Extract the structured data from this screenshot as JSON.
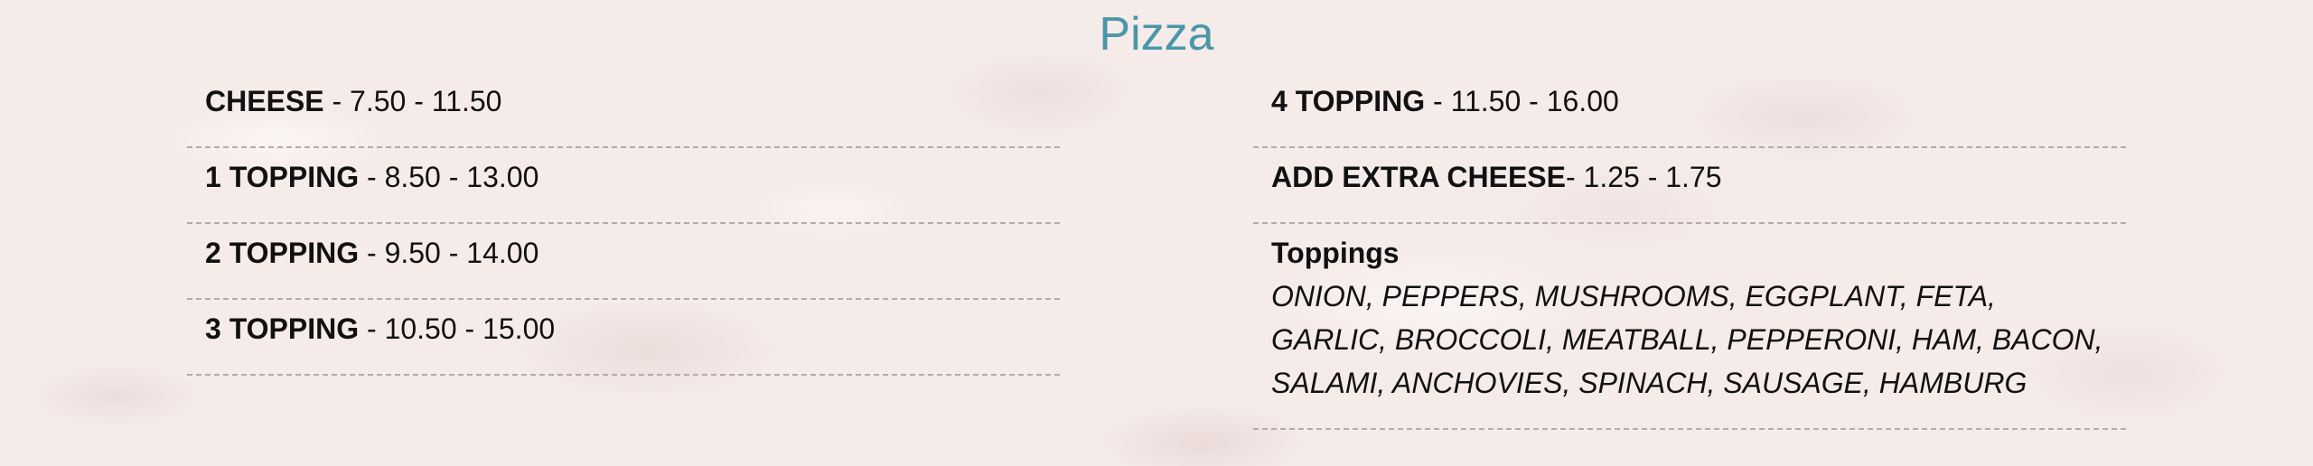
{
  "section": {
    "title": "Pizza"
  },
  "left_column": [
    {
      "name": "CHEESE",
      "price": " - 7.50 - 11.50"
    },
    {
      "name": "1 TOPPING",
      "price": " - 8.50 - 13.00"
    },
    {
      "name": "2 TOPPING",
      "price": " - 9.50 - 14.00"
    },
    {
      "name": "3 TOPPING",
      "price": " - 10.50 - 15.00"
    }
  ],
  "right_column": {
    "items": [
      {
        "name": "4 TOPPING",
        "price": " - 11.50 - 16.00"
      },
      {
        "name": "ADD EXTRA CHEESE",
        "price": "- 1.25 - 1.75"
      }
    ],
    "toppings": {
      "heading": "Toppings",
      "lines": [
        "ONION, PEPPERS, MUSHROOMS, EGGPLANT, FETA,",
        "GARLIC, BROCCOLI, MEATBALL, PEPPERONI, HAM, BACON,",
        "SALAMI, ANCHOVIES, SPINACH, SAUSAGE, HAMBURG"
      ]
    }
  },
  "colors": {
    "title": "#4a97a8",
    "divider": "#b5aba8",
    "background": "#f5ebe9"
  }
}
